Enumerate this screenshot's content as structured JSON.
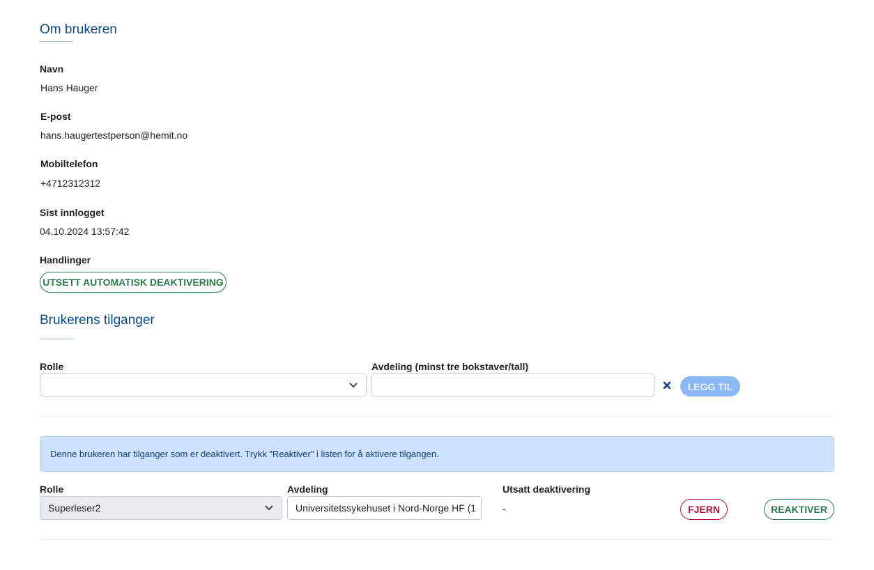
{
  "about": {
    "title": "Om brukeren",
    "name_label": "Navn",
    "name_value": "Hans Hauger",
    "email_label": "E-post",
    "email_value": "hans.haugertestperson@hemit.no",
    "mobile_label": "Mobiltelefon",
    "mobile_value": "+4712312312",
    "last_login_label": "Sist innlogget",
    "last_login_value": "04.10.2024 13:57:42",
    "actions_label": "Handlinger",
    "postpone_button": "UTSETT AUTOMATISK DEAKTIVERING"
  },
  "access": {
    "title": "Brukerens tilganger",
    "role_label": "Rolle",
    "role_value": "",
    "department_label": "Avdeling (minst tre bokstaver/tall)",
    "department_value": "",
    "clear_icon": "close-icon",
    "add_button": "LEGG TIL"
  },
  "alert": {
    "text": "Denne brukeren har tilganger som er deaktivert. Trykk \"Reaktiver\" i listen for å aktivere tilgangen."
  },
  "access_list": {
    "role_header": "Rolle",
    "department_header": "Avdeling",
    "postponed_header": "Utsatt deaktivering",
    "rows": [
      {
        "role": "Superleser2",
        "department": "Universitetssykehuset i Nord-Norge HF  (1",
        "postponed": "-",
        "remove_button": "FJERN",
        "reactivate_button": "REAKTIVER"
      }
    ]
  },
  "colors": {
    "heading": "#0b4a8b",
    "success": "#2c7a4b",
    "danger": "#b0123a",
    "alert_bg": "#cfe2fc",
    "primary_disabled": "#8ab8f4"
  }
}
